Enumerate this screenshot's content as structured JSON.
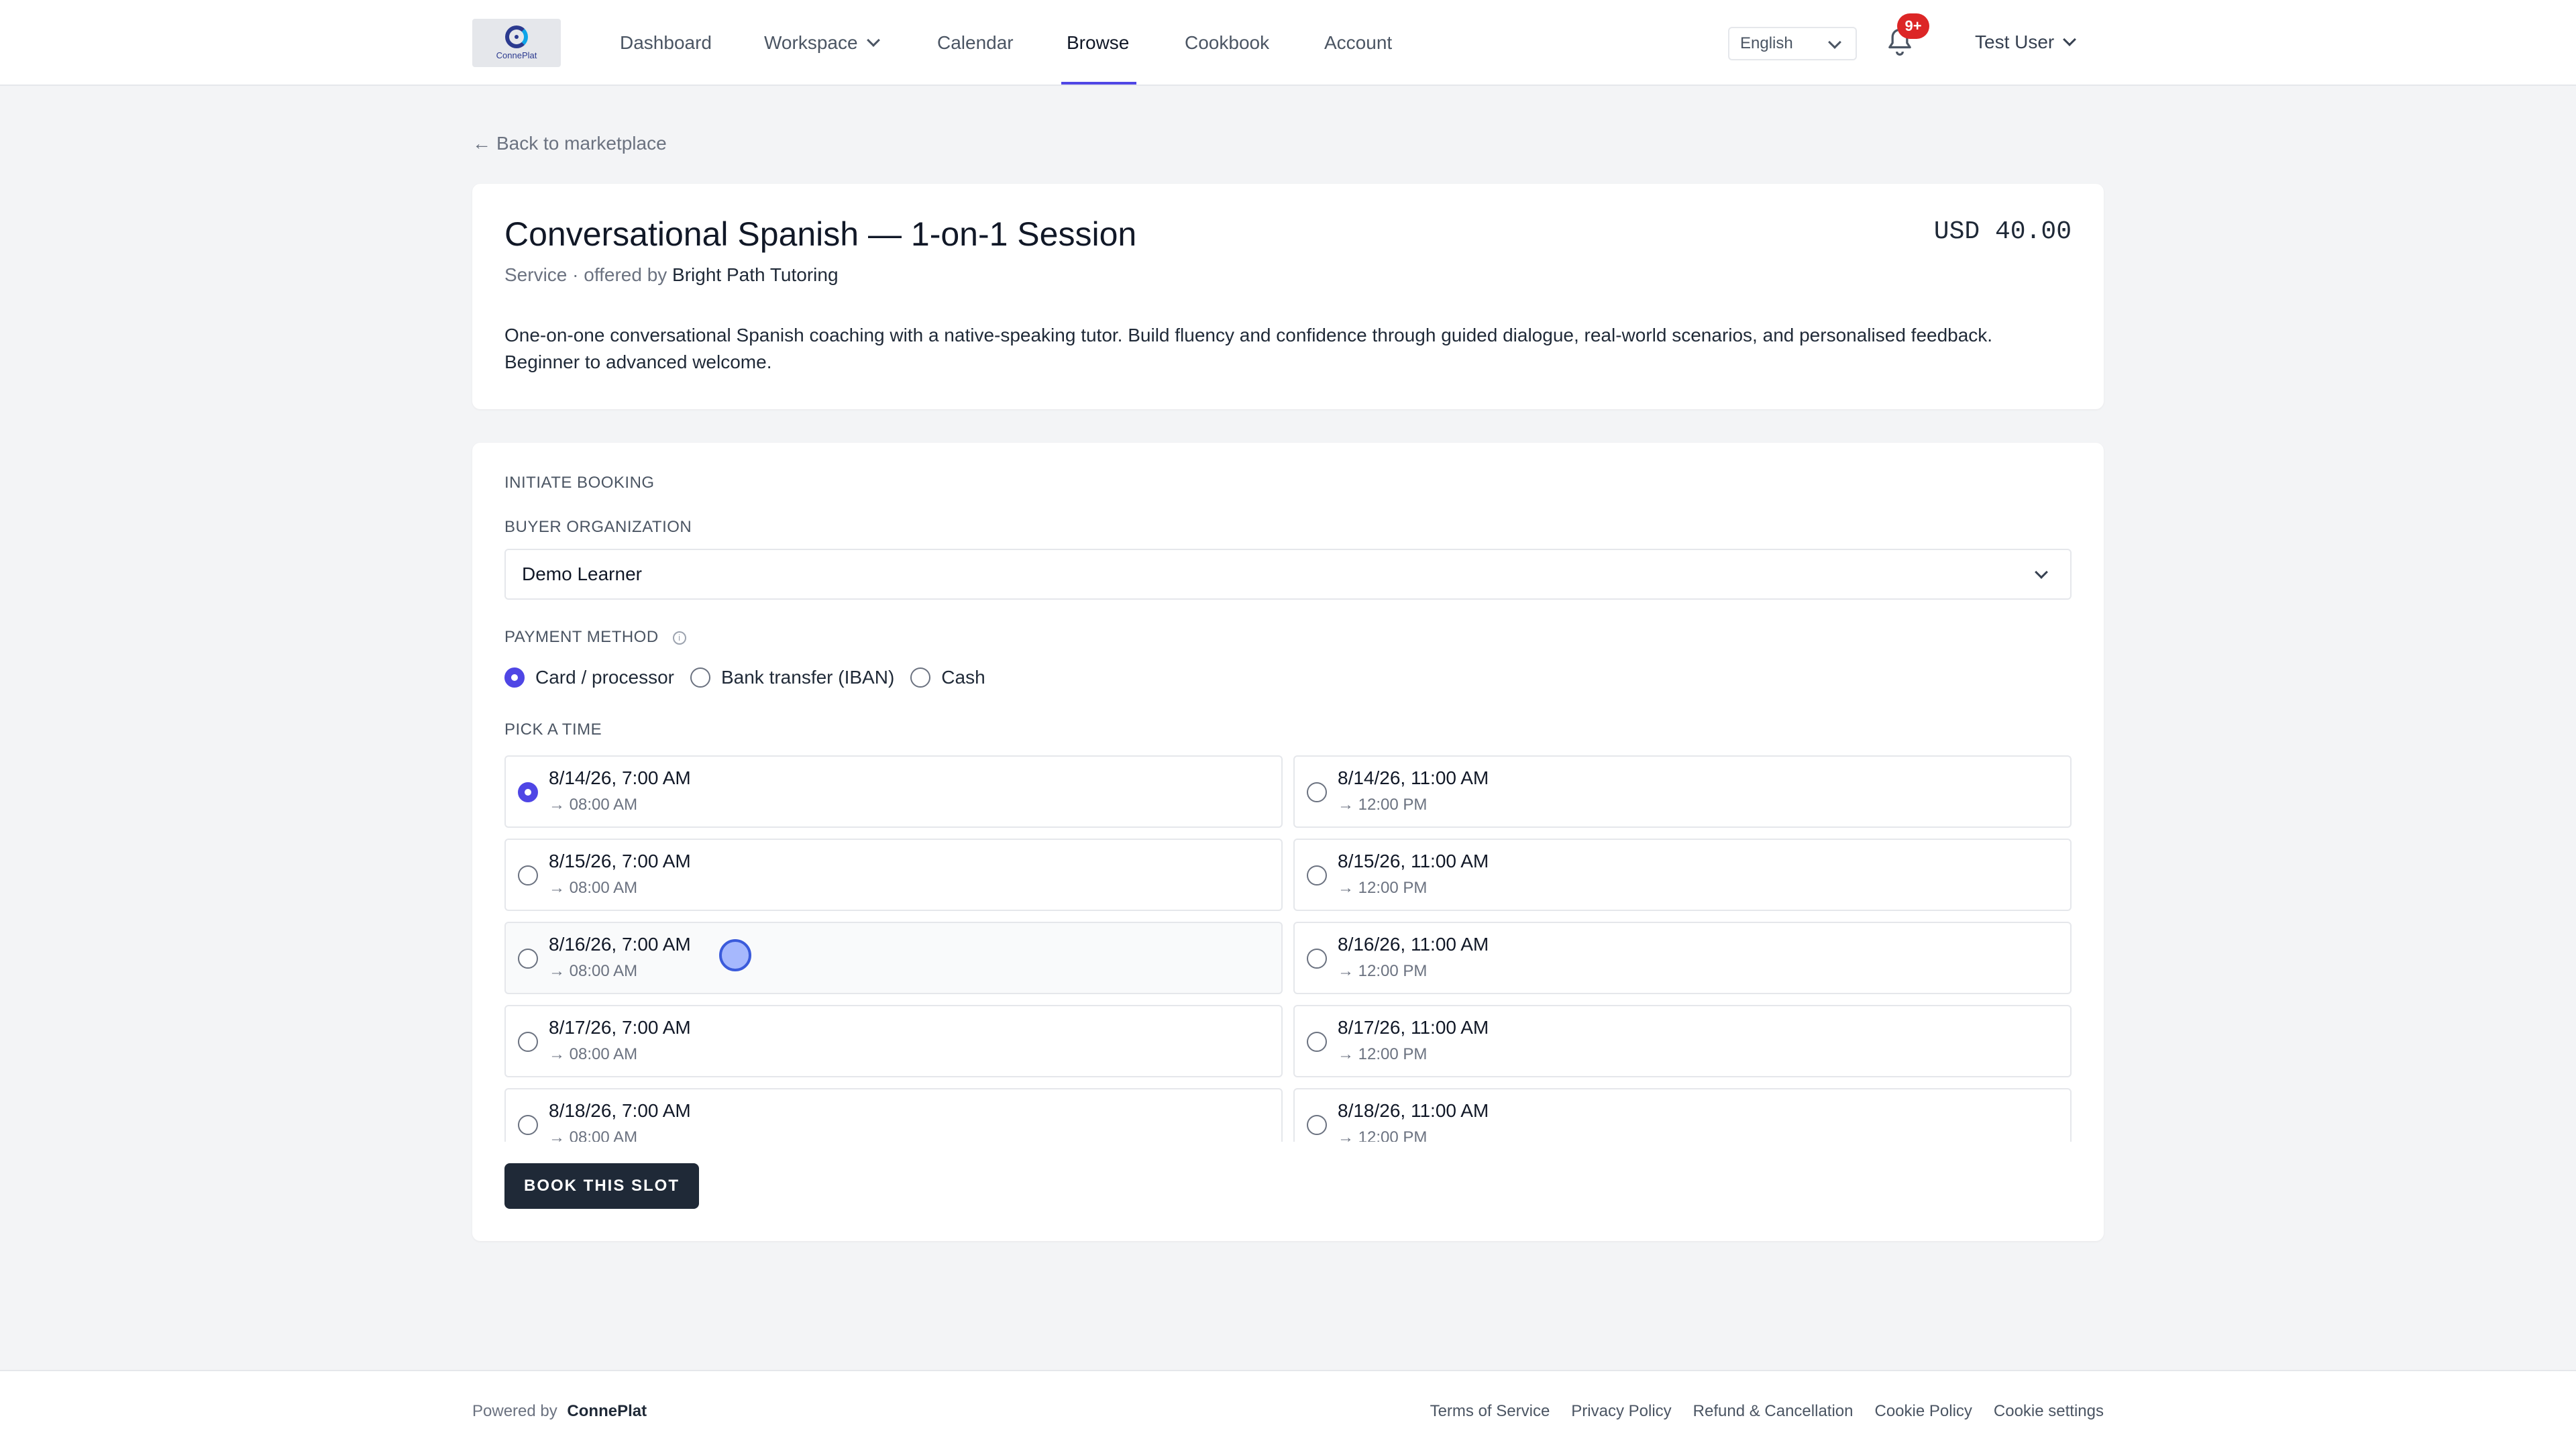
{
  "header": {
    "logo_text": "ConnePlat",
    "nav": [
      "Dashboard",
      "Workspace",
      "Calendar",
      "Browse",
      "Cookbook",
      "Account"
    ],
    "active_nav": "Browse",
    "language": "English",
    "notification_badge": "9+",
    "user_name": "Test User"
  },
  "back_link": "Back to marketplace",
  "listing": {
    "title": "Conversational Spanish — 1-on-1 Session",
    "price": "USD 40.00",
    "subtitle_prefix": "Service · offered by",
    "provider": "Bright Path Tutoring",
    "description": "One-on-one conversational Spanish coaching with a native-speaking tutor. Build fluency and confidence through guided dialogue, real-world scenarios, and personalised feedback. Beginner to advanced welcome."
  },
  "booking": {
    "section_title": "INITIATE BOOKING",
    "buyer_label": "BUYER ORGANIZATION",
    "buyer_value": "Demo Learner",
    "payment_label": "PAYMENT METHOD",
    "payment_options": [
      "Card / processor",
      "Bank transfer (IBAN)",
      "Cash"
    ],
    "payment_selected": "Card / processor",
    "time_label": "PICK A TIME",
    "slots": [
      {
        "start": "8/14/26, 7:00 AM",
        "end": "→ 08:00 AM",
        "selected": true
      },
      {
        "start": "8/14/26, 11:00 AM",
        "end": "→ 12:00 PM",
        "selected": false
      },
      {
        "start": "8/15/26, 7:00 AM",
        "end": "→ 08:00 AM",
        "selected": false
      },
      {
        "start": "8/15/26, 11:00 AM",
        "end": "→ 12:00 PM",
        "selected": false
      },
      {
        "start": "8/16/26, 7:00 AM",
        "end": "→ 08:00 AM",
        "selected": false
      },
      {
        "start": "8/16/26, 11:00 AM",
        "end": "→ 12:00 PM",
        "selected": false
      },
      {
        "start": "8/17/26, 7:00 AM",
        "end": "→ 08:00 AM",
        "selected": false
      },
      {
        "start": "8/17/26, 11:00 AM",
        "end": "→ 12:00 PM",
        "selected": false
      },
      {
        "start": "8/18/26, 7:00 AM",
        "end": "→ 08:00 AM",
        "selected": false
      },
      {
        "start": "8/18/26, 11:00 AM",
        "end": "→ 12:00 PM",
        "selected": false
      }
    ],
    "book_button": "BOOK THIS SLOT"
  },
  "footer": {
    "powered_by": "Powered by",
    "brand": "ConnePlat",
    "links": [
      "Terms of Service",
      "Privacy Policy",
      "Refund & Cancellation",
      "Cookie Policy",
      "Cookie settings"
    ]
  },
  "colors": {
    "accent": "#4f46e5",
    "primary_button": "#1f2937",
    "badge": "#dc2626",
    "page_bg": "#f3f4f6"
  }
}
